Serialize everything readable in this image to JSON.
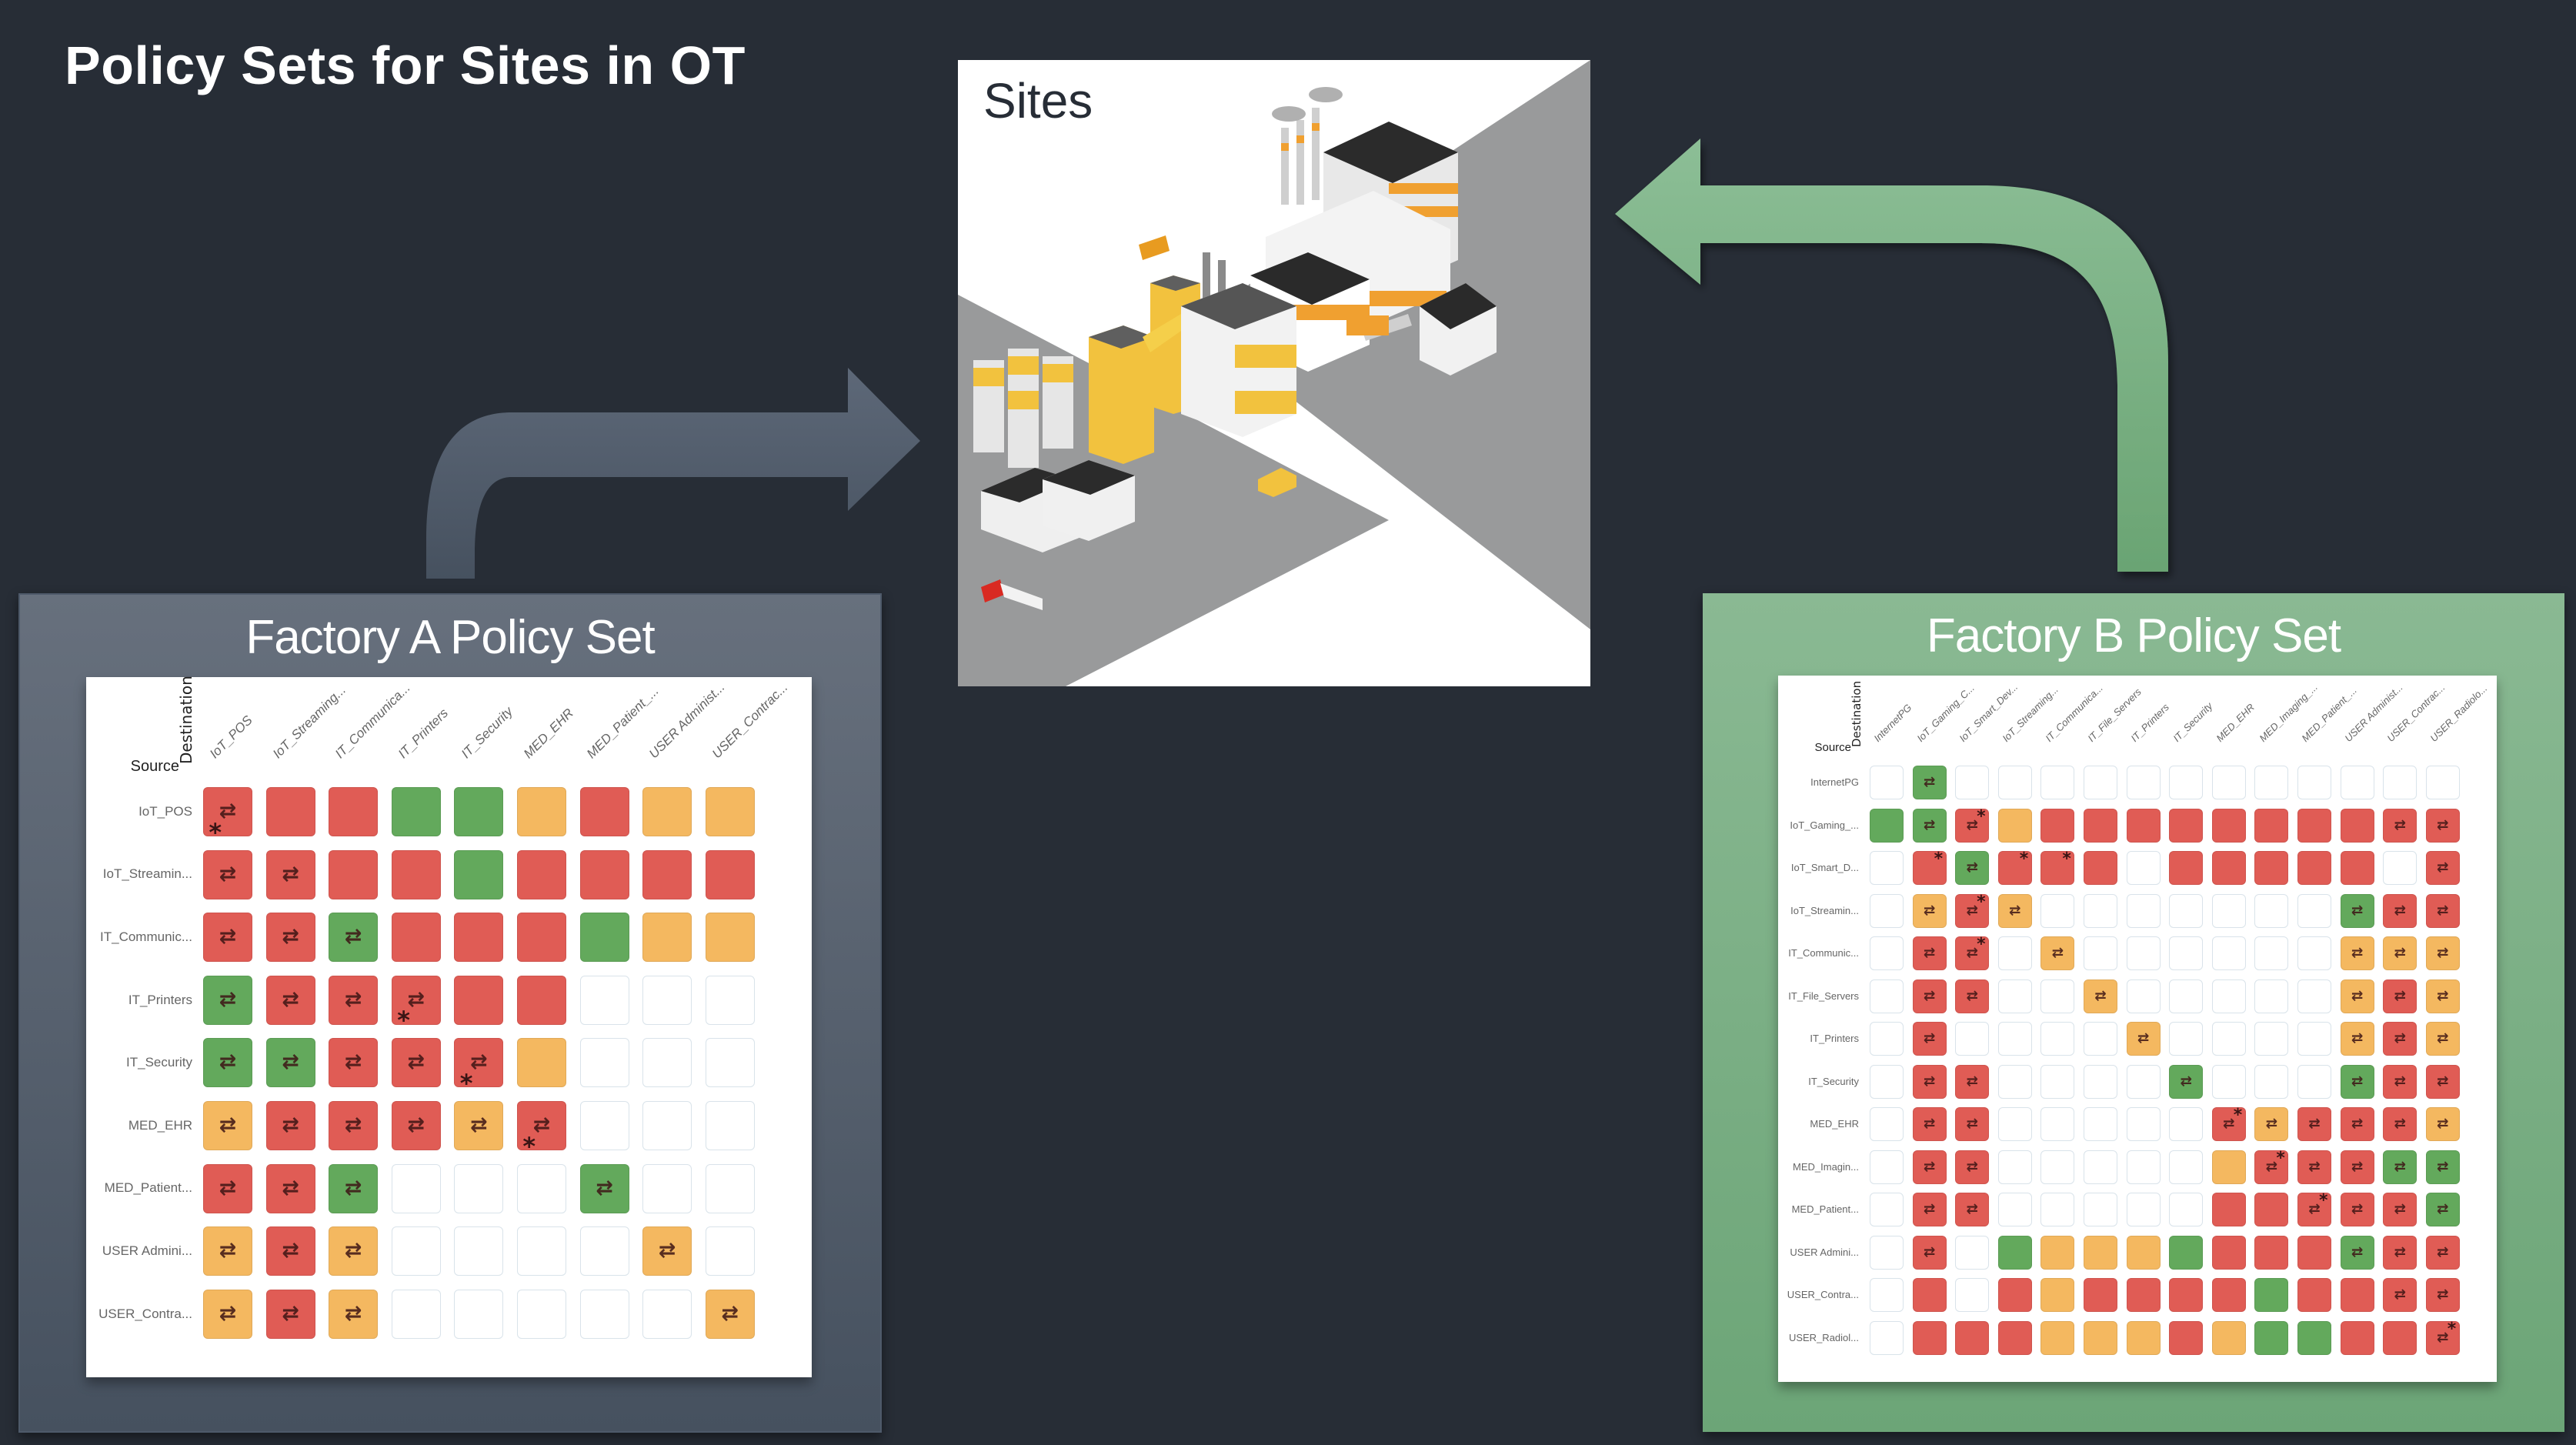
{
  "title": "Policy Sets for Sites in OT",
  "sites": {
    "label": "Sites"
  },
  "colors": {
    "background": "#272d36",
    "deny": "#e05c55",
    "allow": "#63a95c",
    "partial": "#f4b860",
    "empty": "#ffffff",
    "arrow_a": "#56606f",
    "arrow_b": "#80b68b"
  },
  "legend_codes": {
    "R": "deny",
    "G": "allow",
    "Y": "partial",
    "E": "empty",
    "flow": "bidirectional-flow-icon",
    "star": "asterisk-marker"
  },
  "factory_a": {
    "title": "Factory A Policy Set",
    "source_label": "Source",
    "destination_label": "Destination",
    "columns": [
      "IoT_POS",
      "IoT_Streaming...",
      "IT_Communica...",
      "IT_Printers",
      "IT_Security",
      "MED_EHR",
      "MED_Patient_...",
      "USER Administ...",
      "USER_Contrac..."
    ],
    "rows": [
      {
        "label": "IoT_POS",
        "cells": [
          "R:flow:star",
          "R",
          "R",
          "G",
          "G",
          "Y",
          "R",
          "Y",
          "Y"
        ]
      },
      {
        "label": "IoT_Streamin...",
        "cells": [
          "R:flow",
          "R:flow",
          "R",
          "R",
          "G",
          "R",
          "R",
          "R",
          "R"
        ]
      },
      {
        "label": "IT_Communic...",
        "cells": [
          "R:flow",
          "R:flow",
          "G:flow",
          "R",
          "R",
          "R",
          "G",
          "Y",
          "Y"
        ]
      },
      {
        "label": "IT_Printers",
        "cells": [
          "G:flow",
          "R:flow",
          "R:flow",
          "R:flow:star",
          "R",
          "R",
          "E",
          "E",
          "E"
        ]
      },
      {
        "label": "IT_Security",
        "cells": [
          "G:flow",
          "G:flow",
          "R:flow",
          "R:flow",
          "R:flow:star",
          "Y",
          "E",
          "E",
          "E"
        ]
      },
      {
        "label": "MED_EHR",
        "cells": [
          "Y:flow",
          "R:flow",
          "R:flow",
          "R:flow",
          "Y:flow",
          "R:flow:star",
          "E",
          "E",
          "E"
        ]
      },
      {
        "label": "MED_Patient...",
        "cells": [
          "R:flow",
          "R:flow",
          "G:flow",
          "E",
          "E",
          "E",
          "G:flow",
          "E",
          "E"
        ]
      },
      {
        "label": "USER Admini...",
        "cells": [
          "Y:flow",
          "R:flow",
          "Y:flow",
          "E",
          "E",
          "E",
          "E",
          "Y:flow",
          "E"
        ]
      },
      {
        "label": "USER_Contra...",
        "cells": [
          "Y:flow",
          "R:flow",
          "Y:flow",
          "E",
          "E",
          "E",
          "E",
          "E",
          "Y:flow"
        ]
      }
    ]
  },
  "factory_b": {
    "title": "Factory B Policy Set",
    "source_label": "Source",
    "destination_label": "Destination",
    "columns": [
      "InternetPG",
      "IoT_Gaming_C...",
      "IoT_Smart_Dev...",
      "IoT_Streaming...",
      "IT_Communica...",
      "IT_File_Servers",
      "IT_Printers",
      "IT_Security",
      "MED_EHR",
      "MED_Imaging_...",
      "MED_Patient_...",
      "USER Administ...",
      "USER_Contrac...",
      "USER_Radiolo..."
    ],
    "rows": [
      {
        "label": "InternetPG",
        "cells": [
          "E",
          "G:flow",
          "E",
          "E",
          "E",
          "E",
          "E",
          "E",
          "E",
          "E",
          "E",
          "E",
          "E",
          "E"
        ]
      },
      {
        "label": "IoT_Gaming_...",
        "cells": [
          "G",
          "G:flow",
          "R:flow:star",
          "Y",
          "R",
          "R",
          "R",
          "R",
          "R",
          "R",
          "R",
          "R",
          "R:flow",
          "R:flow"
        ]
      },
      {
        "label": "IoT_Smart_D...",
        "cells": [
          "E",
          "R:star",
          "G:flow",
          "R:star",
          "R:star",
          "R",
          "E",
          "R",
          "R",
          "R",
          "R",
          "R",
          "E",
          "R:flow"
        ]
      },
      {
        "label": "IoT_Streamin...",
        "cells": [
          "E",
          "Y:flow",
          "R:flow:star",
          "Y:flow",
          "E",
          "E",
          "E",
          "E",
          "E",
          "E",
          "E",
          "G:flow",
          "R:flow",
          "R:flow"
        ]
      },
      {
        "label": "IT_Communic...",
        "cells": [
          "E",
          "R:flow",
          "R:flow:star",
          "E",
          "Y:flow",
          "E",
          "E",
          "E",
          "E",
          "E",
          "E",
          "Y:flow",
          "Y:flow",
          "Y:flow"
        ]
      },
      {
        "label": "IT_File_Servers",
        "cells": [
          "E",
          "R:flow",
          "R:flow",
          "E",
          "E",
          "Y:flow",
          "E",
          "E",
          "E",
          "E",
          "E",
          "Y:flow",
          "R:flow",
          "Y:flow"
        ]
      },
      {
        "label": "IT_Printers",
        "cells": [
          "E",
          "R:flow",
          "E",
          "E",
          "E",
          "E",
          "Y:flow",
          "E",
          "E",
          "E",
          "E",
          "Y:flow",
          "R:flow",
          "Y:flow"
        ]
      },
      {
        "label": "IT_Security",
        "cells": [
          "E",
          "R:flow",
          "R:flow",
          "E",
          "E",
          "E",
          "E",
          "G:flow",
          "E",
          "E",
          "E",
          "G:flow",
          "R:flow",
          "R:flow"
        ]
      },
      {
        "label": "MED_EHR",
        "cells": [
          "E",
          "R:flow",
          "R:flow",
          "E",
          "E",
          "E",
          "E",
          "E",
          "R:flow:star",
          "Y:flow",
          "R:flow",
          "R:flow",
          "R:flow",
          "Y:flow"
        ]
      },
      {
        "label": "MED_Imagin...",
        "cells": [
          "E",
          "R:flow",
          "R:flow",
          "E",
          "E",
          "E",
          "E",
          "E",
          "Y",
          "R:flow:star",
          "R:flow",
          "R:flow",
          "G:flow",
          "G:flow"
        ]
      },
      {
        "label": "MED_Patient...",
        "cells": [
          "E",
          "R:flow",
          "R:flow",
          "E",
          "E",
          "E",
          "E",
          "E",
          "R",
          "R",
          "R:flow:star",
          "R:flow",
          "R:flow",
          "G:flow"
        ]
      },
      {
        "label": "USER Admini...",
        "cells": [
          "E",
          "R:flow",
          "E",
          "G",
          "Y",
          "Y",
          "Y",
          "G",
          "R",
          "R",
          "R",
          "G:flow",
          "R:flow",
          "R:flow"
        ]
      },
      {
        "label": "USER_Contra...",
        "cells": [
          "E",
          "R",
          "E",
          "R",
          "Y",
          "R",
          "R",
          "R",
          "R",
          "G",
          "R",
          "R",
          "R:flow",
          "R:flow"
        ]
      },
      {
        "label": "USER_Radiol...",
        "cells": [
          "E",
          "R",
          "R",
          "R",
          "Y",
          "Y",
          "Y",
          "R",
          "Y",
          "G",
          "G",
          "R",
          "R",
          "R:flow:star"
        ]
      }
    ]
  }
}
